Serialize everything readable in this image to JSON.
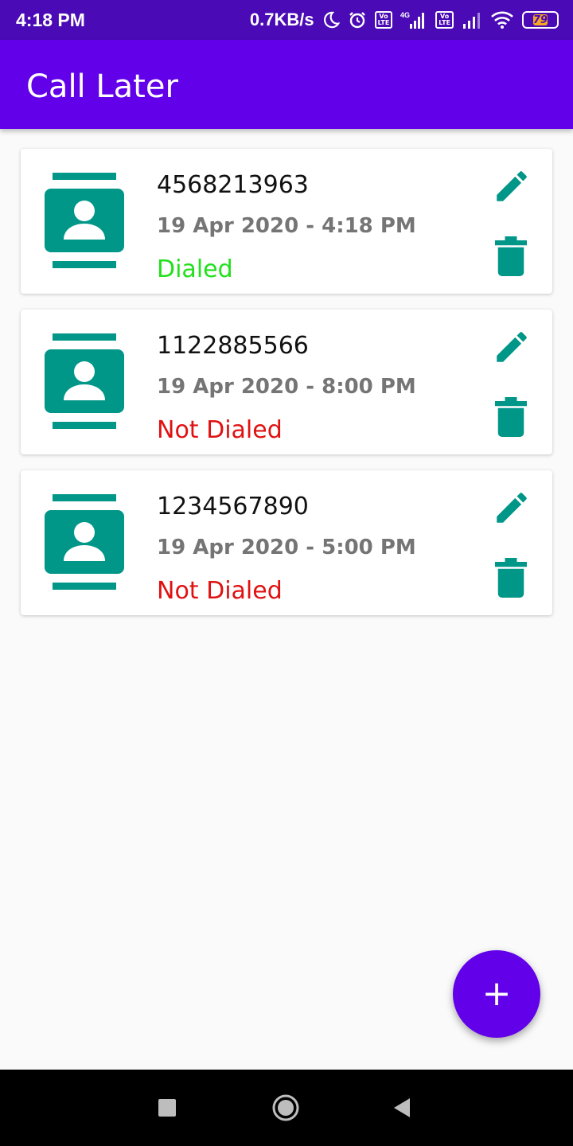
{
  "status_bar": {
    "time": "4:18 PM",
    "net_speed": "0.7KB/s",
    "icons": [
      "moon-icon",
      "alarm-icon",
      "volte-icon",
      "signal-4g-icon",
      "volte-icon",
      "signal-icon",
      "wifi-icon",
      "battery-icon"
    ],
    "volte_label": "Vo\nLTE",
    "network_label": "4G",
    "battery_level": "79"
  },
  "app_bar": {
    "title": "Call Later"
  },
  "calls": [
    {
      "phone": "4568213963",
      "datetime": "19 Apr 2020 - 4:18 PM",
      "status": "Dialed"
    },
    {
      "phone": "1122885566",
      "datetime": "19 Apr 2020 - 8:00 PM",
      "status": "Not Dialed"
    },
    {
      "phone": "1234567890",
      "datetime": "19 Apr 2020 - 5:00 PM",
      "status": "Not Dialed"
    }
  ],
  "fab": {
    "label": "+",
    "icon": "add-icon"
  },
  "colors": {
    "accent": "#6200ea",
    "status_bar": "#4a0ab5",
    "icon_teal": "#009688",
    "dialed": "#22e01c",
    "not_dialed": "#e01111"
  },
  "nav_bar": {
    "icons": [
      "recents-icon",
      "home-icon",
      "back-icon"
    ]
  }
}
